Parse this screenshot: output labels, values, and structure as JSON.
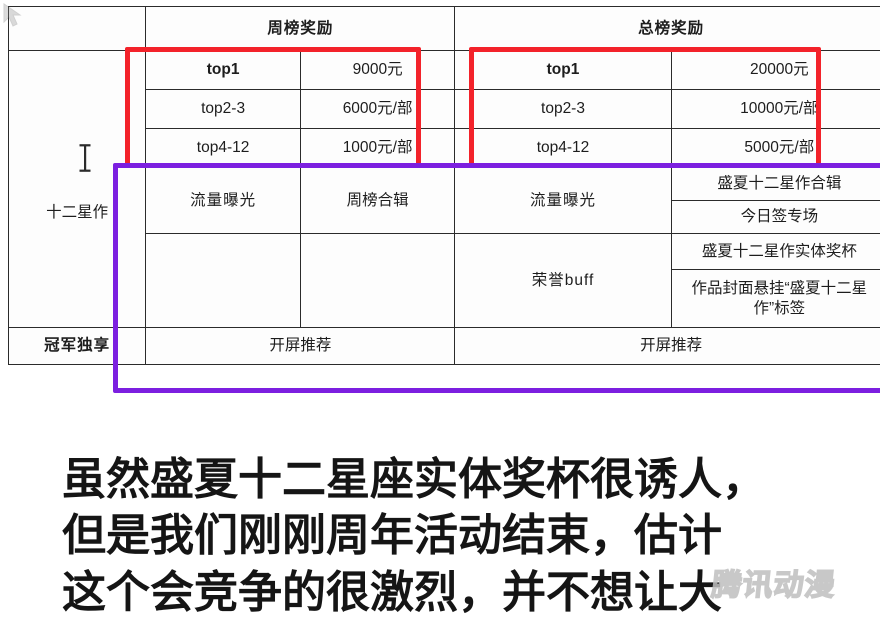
{
  "table": {
    "headers": {
      "blank_corner": "",
      "weekly": "周榜奖励",
      "total": "总榜奖励"
    },
    "row_labels": {
      "program": "十二星作",
      "champion": "冠军独享"
    },
    "weekly_ranks": [
      {
        "rank": "top1",
        "amount": "9000元"
      },
      {
        "rank": "top2-3",
        "amount": "6000元/部"
      },
      {
        "rank": "top4-12",
        "amount": "1000元/部"
      }
    ],
    "total_ranks": [
      {
        "rank": "top1",
        "amount": "20000元"
      },
      {
        "rank": "top2-3",
        "amount": "10000元/部"
      },
      {
        "rank": "top4-12",
        "amount": "5000元/部"
      }
    ],
    "weekly_benefits": {
      "flow_label": "流量曝光",
      "flow_value": "周榜合辑",
      "honor_label": "",
      "honor_values": [
        "",
        ""
      ]
    },
    "total_benefits": {
      "flow_label": "流量曝光",
      "flow_values": [
        "盛夏十二星作合辑",
        "今日签专场"
      ],
      "honor_label": "荣誉buff",
      "honor_values": [
        "盛夏十二星作实体奖杯",
        "作品封面悬挂“盛夏十二星作”标签"
      ]
    },
    "champion_row": {
      "weekly": "开屏推荐",
      "total": "开屏推荐"
    }
  },
  "annotations": {
    "red_color": "#f3222a",
    "purple_color": "#7c1fe0",
    "red_box_left_name": "weekly-cash-reward-highlight",
    "red_box_right_name": "total-cash-reward-highlight",
    "purple_box_name": "benefits-highlight"
  },
  "cursor": {
    "text_caret_name": "text-ibeam-cursor"
  },
  "caption": {
    "text": "虽然盛夏十二星座实体奖杯很诱人，\n但是我们刚刚周年活动结束，估计\n这个会竞争的很激烈，并不想让大"
  },
  "watermark": {
    "text": "腾讯动漫"
  }
}
